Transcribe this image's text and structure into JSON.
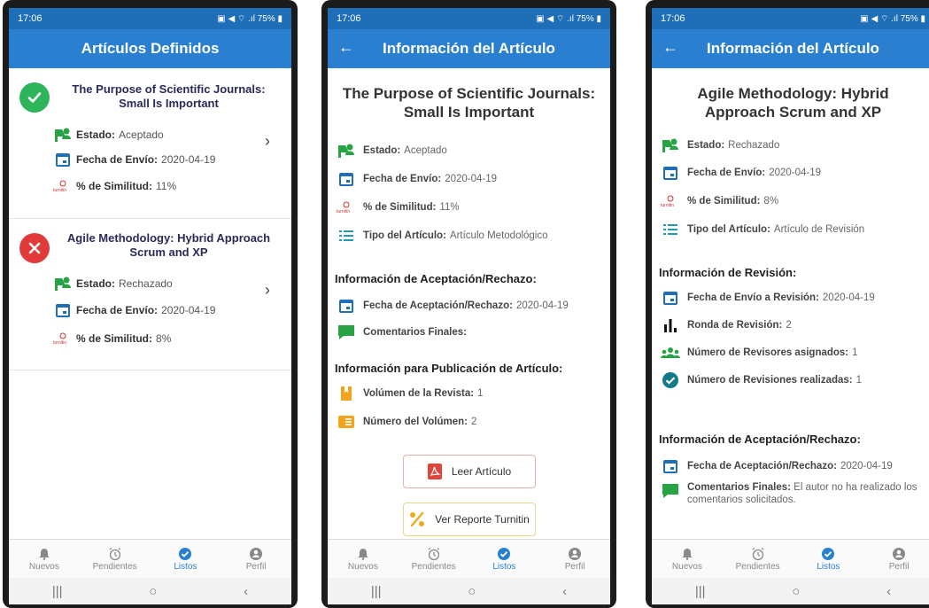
{
  "status": {
    "time": "17:06",
    "right": "▣ ◀ ⌔ .ıl 75% ▮"
  },
  "nav": {
    "items": [
      "Nuevos",
      "Pendientes",
      "Listos",
      "Perfil"
    ]
  },
  "labels": {
    "estado": "Estado:",
    "fecha_envio": "Fecha de Envío:",
    "similitud": "% de Similitud:",
    "tipo": "Tipo del Artículo:",
    "fecha_aceptacion": "Fecha de Aceptación/Rechazo:",
    "comentarios": "Comentarios Finales:",
    "volumen": "Volúmen de la Revista:",
    "numero_volumen": "Número del Volúmen:",
    "fecha_envio_revision": "Fecha de Envío a Revisión:",
    "ronda": "Ronda de Revisión:",
    "revisores": "Número de Revisores asignados:",
    "revisiones": "Número de Revisiones realizadas:",
    "turnitin_logo": "turnitin"
  },
  "screen1": {
    "title": "Artículos Definidos",
    "articles": [
      {
        "title": "The Purpose of Scientific Journals: Small Is Important",
        "estado": "Aceptado",
        "fecha": "2020-04-19",
        "similitud": "11%"
      },
      {
        "title": "Agile Methodology: Hybrid Approach Scrum and XP",
        "estado": "Rechazado",
        "fecha": "2020-04-19",
        "similitud": "8%"
      }
    ]
  },
  "screen2": {
    "title": "Información del Artículo",
    "article_title": "The Purpose of Scientific Journals: Small Is Important",
    "estado": "Aceptado",
    "fecha": "2020-04-19",
    "similitud": "11%",
    "tipo": "Artículo Metodológico",
    "section1": "Información de Aceptación/Rechazo:",
    "fecha_aceptacion": "2020-04-19",
    "comentarios": "",
    "section2": "Información para Publicación de Artículo:",
    "volumen": "1",
    "numero_volumen": "2",
    "btn_leer": "Leer Artículo",
    "btn_turnitin": "Ver Reporte Turnitin"
  },
  "screen3": {
    "title": "Información del Artículo",
    "article_title": "Agile Methodology: Hybrid Approach Scrum and XP",
    "estado": "Rechazado",
    "fecha": "2020-04-19",
    "similitud": "8%",
    "tipo": "Artículo de Revisión",
    "section1": "Información de Revisión:",
    "fecha_envio_revision": "2020-04-19",
    "ronda": "2",
    "revisores": "1",
    "revisiones": "1",
    "section2": "Información de Aceptación/Rechazo:",
    "fecha_aceptacion": "2020-04-19",
    "comentarios": "El autor no ha realizado los comentarios solicitados."
  },
  "colors": {
    "appbar": "#2a7fd0",
    "accept": "#2eb45a",
    "reject": "#e03a3a",
    "icon_blue": "#1f6fb8",
    "icon_green": "#27a346"
  }
}
